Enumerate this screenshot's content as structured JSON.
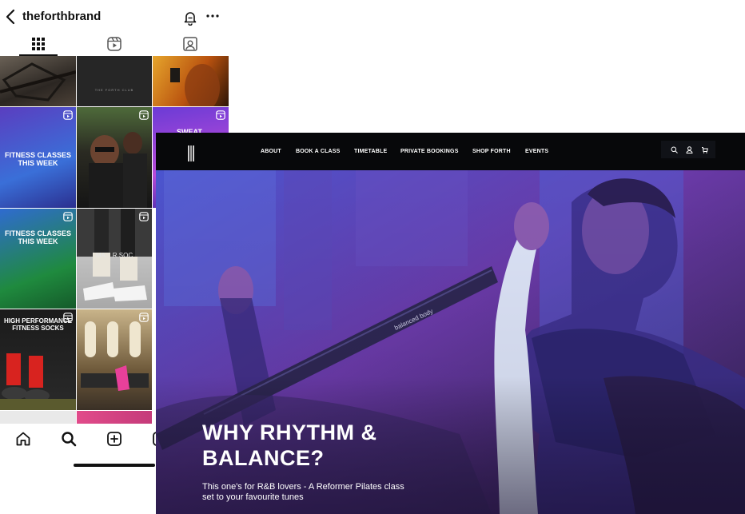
{
  "instagram": {
    "username": "theforthbrand",
    "grid_tiles": [
      {
        "text": ""
      },
      {
        "text": "THE FORTH CLUB"
      },
      {
        "text": ""
      },
      {
        "text": "FITNESS CLASSES THIS WEEK"
      },
      {
        "text": ""
      },
      {
        "text": "SWEAT"
      },
      {
        "text": "FITNESS CLASSES THIS WEEK"
      },
      {
        "text": "MA... R SOC"
      },
      {
        "text": ""
      },
      {
        "text": "HIGH PERFORMANCE FITNESS SOCKS"
      },
      {
        "text": ""
      },
      {
        "text": ""
      }
    ]
  },
  "website": {
    "nav_links": [
      "ABOUT",
      "BOOK A CLASS",
      "TIMETABLE",
      "PRIVATE BOOKINGS",
      "SHOP FORTH",
      "EVENTS"
    ],
    "hero_title": "WHY RHYTHM & BALANCE?",
    "hero_subtitle": "This one's for R&B lovers - A Reformer Pilates class set to your favourite tunes",
    "strap_text": "balanced body"
  },
  "colors": {
    "nav_bg": "#07080a",
    "hero_purple": "#5b3fa8",
    "hero_blue": "#3d5be0"
  }
}
